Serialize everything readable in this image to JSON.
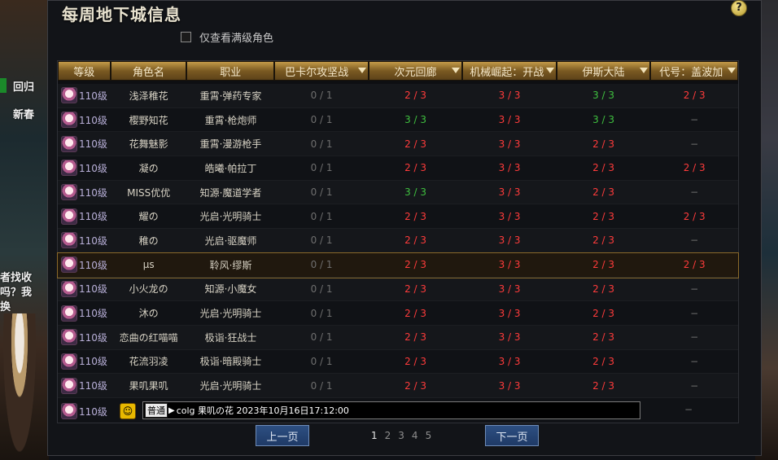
{
  "background": {
    "fragments": [
      "回归",
      "新春",
      "者找收",
      "吗？我",
      "换"
    ]
  },
  "window": {
    "title": "每周地下城信息",
    "help_glyph": "?",
    "filter_label": "仅查看满级角色"
  },
  "table": {
    "headers": {
      "level": "等级",
      "name": "角色名",
      "job": "职业",
      "d1": "巴卡尔攻坚战",
      "d2": "次元回廊",
      "d3": "机械崛起：开战",
      "d4": "伊斯大陆",
      "d5": "代号：盖波加"
    },
    "rows": [
      {
        "level": "110级",
        "name": "浅泽稚花",
        "job": "重霄·弹药专家",
        "d1": "0 / 1",
        "d2": "2 / 3",
        "d3": "3 / 3",
        "d4": "3 / 3",
        "d5": "2 / 3",
        "d2c": "red",
        "d3c": "red",
        "d4c": "green",
        "d5c": "red"
      },
      {
        "level": "110级",
        "name": "樱野知花",
        "job": "重霄·枪炮师",
        "d1": "0 / 1",
        "d2": "3 / 3",
        "d3": "3 / 3",
        "d4": "3 / 3",
        "d5": "−",
        "d2c": "green",
        "d3c": "red",
        "d4c": "green",
        "d5c": "dash"
      },
      {
        "level": "110级",
        "name": "花舞魅影",
        "job": "重霄·漫游枪手",
        "d1": "0 / 1",
        "d2": "2 / 3",
        "d3": "3 / 3",
        "d4": "2 / 3",
        "d5": "−",
        "d2c": "red",
        "d3c": "red",
        "d4c": "red",
        "d5c": "dash"
      },
      {
        "level": "110级",
        "name": "凝の",
        "job": "皓曦·帕拉丁",
        "d1": "0 / 1",
        "d2": "2 / 3",
        "d3": "3 / 3",
        "d4": "2 / 3",
        "d5": "2 / 3",
        "d2c": "red",
        "d3c": "red",
        "d4c": "red",
        "d5c": "red"
      },
      {
        "level": "110级",
        "name": "MISS优优",
        "job": "知源·魔道学者",
        "d1": "0 / 1",
        "d2": "3 / 3",
        "d3": "3 / 3",
        "d4": "2 / 3",
        "d5": "−",
        "d2c": "green",
        "d3c": "red",
        "d4c": "red",
        "d5c": "dash"
      },
      {
        "level": "110级",
        "name": "耀の",
        "job": "光启·光明骑士",
        "d1": "0 / 1",
        "d2": "2 / 3",
        "d3": "3 / 3",
        "d4": "2 / 3",
        "d5": "2 / 3",
        "d2c": "red",
        "d3c": "red",
        "d4c": "red",
        "d5c": "red"
      },
      {
        "level": "110级",
        "name": "稚の",
        "job": "光启·驱魔师",
        "d1": "0 / 1",
        "d2": "2 / 3",
        "d3": "3 / 3",
        "d4": "2 / 3",
        "d5": "−",
        "d2c": "red",
        "d3c": "red",
        "d4c": "red",
        "d5c": "dash"
      },
      {
        "level": "110级",
        "name": "μs",
        "job": "聆风·缪斯",
        "d1": "0 / 1",
        "d2": "2 / 3",
        "d3": "3 / 3",
        "d4": "2 / 3",
        "d5": "2 / 3",
        "d2c": "red",
        "d3c": "red",
        "d4c": "red",
        "d5c": "red"
      },
      {
        "level": "110级",
        "name": "小火龙の",
        "job": "知源·小魔女",
        "d1": "0 / 1",
        "d2": "2 / 3",
        "d3": "3 / 3",
        "d4": "2 / 3",
        "d5": "−",
        "d2c": "red",
        "d3c": "red",
        "d4c": "red",
        "d5c": "dash"
      },
      {
        "level": "110级",
        "name": "沐の",
        "job": "光启·光明骑士",
        "d1": "0 / 1",
        "d2": "2 / 3",
        "d3": "3 / 3",
        "d4": "2 / 3",
        "d5": "−",
        "d2c": "red",
        "d3c": "red",
        "d4c": "red",
        "d5c": "dash"
      },
      {
        "level": "110级",
        "name": "恋曲の红喵喵",
        "job": "极诣·狂战士",
        "d1": "0 / 1",
        "d2": "2 / 3",
        "d3": "3 / 3",
        "d4": "2 / 3",
        "d5": "−",
        "d2c": "red",
        "d3c": "red",
        "d4c": "red",
        "d5c": "dash"
      },
      {
        "level": "110级",
        "name": "花流羽凌",
        "job": "极诣·暗殿骑士",
        "d1": "0 / 1",
        "d2": "2 / 3",
        "d3": "3 / 3",
        "d4": "2 / 3",
        "d5": "−",
        "d2c": "red",
        "d3c": "red",
        "d4c": "red",
        "d5c": "dash"
      },
      {
        "level": "110级",
        "name": "果叽果叽",
        "job": "光启·光明骑士",
        "d1": "0 / 1",
        "d2": "2 / 3",
        "d3": "3 / 3",
        "d4": "2 / 3",
        "d5": "−",
        "d2c": "red",
        "d3c": "red",
        "d4c": "red",
        "d5c": "dash"
      }
    ],
    "selected_index": 7,
    "chat_row": {
      "level": "110级",
      "channel": "普通",
      "text": "colg 果叽の花 2023年10月16日17:12:00",
      "d5": "−"
    }
  },
  "pagination": {
    "prev_label": "上一页",
    "next_label": "下一页",
    "pages": [
      "1",
      "2",
      "3",
      "4",
      "5"
    ],
    "current_page": "1"
  },
  "colors": {
    "red": "#ff3b3b",
    "green": "#3fc03f",
    "header_gold": "#c39a48",
    "button_blue": "#1f3a66"
  }
}
